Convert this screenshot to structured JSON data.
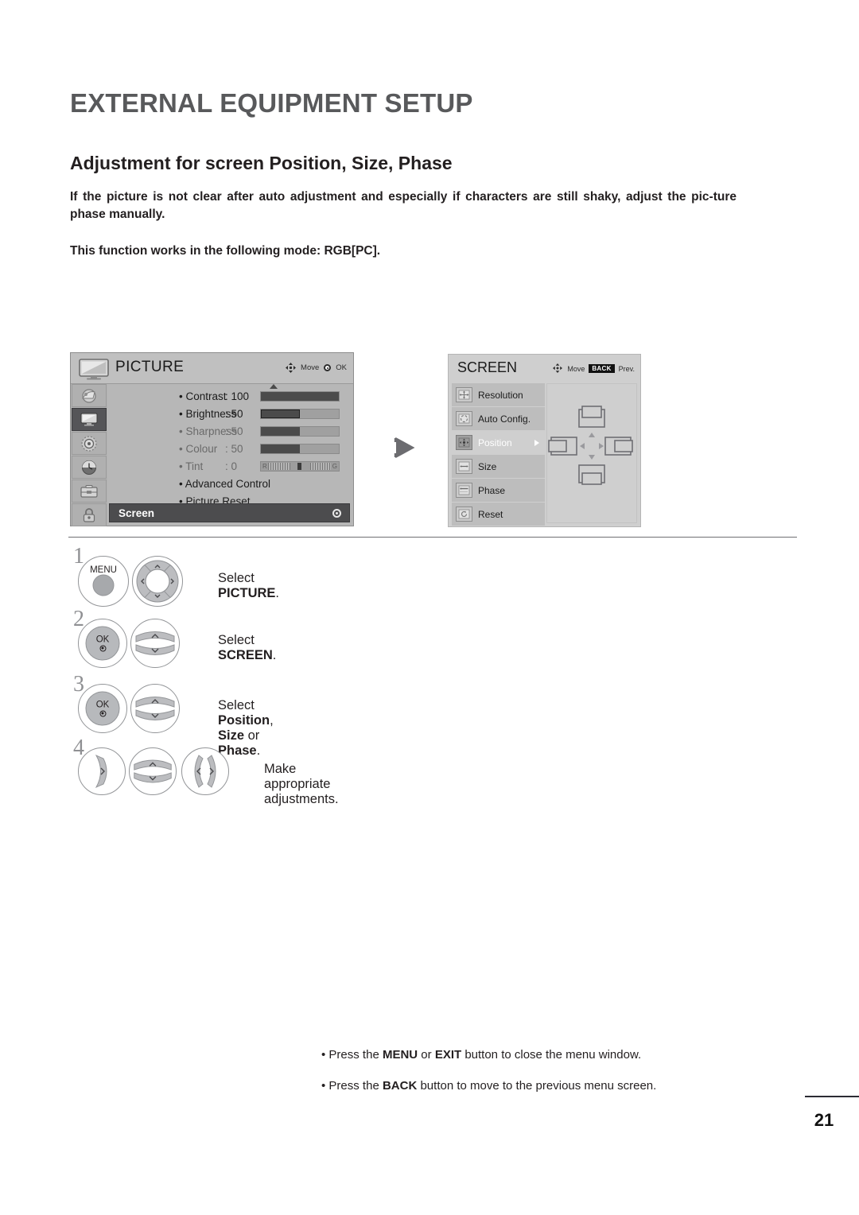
{
  "header": {
    "page_title": "EXTERNAL EQUIPMENT SETUP",
    "section_title": "Adjustment for screen Position, Size, Phase",
    "paragraph_1": "If the picture is not clear after auto adjustment and especially if characters are still shaky, adjust the pic-ture phase manually.",
    "paragraph_2": "This function works in the following mode: RGB[PC]."
  },
  "picture_menu": {
    "title": "PICTURE",
    "hint_move": "Move",
    "hint_ok": "OK",
    "rail_icons": [
      "setup-icon",
      "picture-icon",
      "audio-icon",
      "time-icon",
      "option-icon",
      "lock-icon"
    ],
    "active_rail_index": 1,
    "items": [
      {
        "label": "Contrast",
        "value": ": 100",
        "fill": 100,
        "dim": false,
        "type": "slider"
      },
      {
        "label": "Brightness",
        "value": ": 50",
        "fill": 50,
        "dim": false,
        "type": "slider"
      },
      {
        "label": "Sharpness",
        "value": ": 50",
        "fill": 50,
        "dim": true,
        "type": "slider"
      },
      {
        "label": "Colour",
        "value": ": 50",
        "fill": 50,
        "dim": true,
        "type": "slider"
      },
      {
        "label": "Tint",
        "value": ": 0",
        "fill": 50,
        "dim": true,
        "type": "tint"
      },
      {
        "label": "Advanced Control",
        "value": "",
        "fill": 0,
        "dim": false,
        "type": "plain"
      },
      {
        "label": "Picture Reset",
        "value": "",
        "fill": 0,
        "dim": false,
        "type": "plain"
      }
    ],
    "tint_left_label": "R",
    "tint_right_label": "G",
    "selected_row": "Screen"
  },
  "screen_menu": {
    "title": "SCREEN",
    "hint_move": "Move",
    "hint_back_chip": "BACK",
    "hint_back_label": "Prev.",
    "items": [
      {
        "label": "Resolution",
        "icon": "resolution-icon",
        "selected": false
      },
      {
        "label": "Auto Config.",
        "icon": "auto-config-icon",
        "selected": false
      },
      {
        "label": "Position",
        "icon": "position-icon",
        "selected": true
      },
      {
        "label": "Size",
        "icon": "size-icon",
        "selected": false
      },
      {
        "label": "Phase",
        "icon": "phase-icon",
        "selected": false
      },
      {
        "label": "Reset",
        "icon": "reset-icon",
        "selected": false
      }
    ]
  },
  "steps": [
    {
      "num": "1",
      "text_plain": "Select ",
      "text_bold": "PICTURE",
      "text_tail": ".",
      "menu_label": "MENU"
    },
    {
      "num": "2",
      "text_plain": "Select ",
      "text_bold": "SCREEN",
      "text_tail": ".",
      "ok_label": "OK"
    },
    {
      "num": "3",
      "text_plain": "Select ",
      "text_bold": "Position",
      "text_mid": ", ",
      "text_bold2": "Size",
      "text_mid2": " or ",
      "text_bold3": "Phase",
      "text_tail": ".",
      "ok_label": "OK"
    },
    {
      "num": "4",
      "text_plain": "Make appropriate adjustments."
    }
  ],
  "notes": {
    "note_1_pre": "• Press the ",
    "note_1_b1": "MENU",
    "note_1_mid": " or ",
    "note_1_b2": "EXIT",
    "note_1_post": " button to close the menu window.",
    "note_2_pre": "• Press the ",
    "note_2_b1": "BACK",
    "note_2_post": " button to move to the previous menu screen."
  },
  "page_number": "21",
  "colors": {
    "title_grey": "#58595b",
    "osd_dark": "#4c4c4e",
    "osd_light": "#b7b7b7",
    "button_grey": "#bcbdc0"
  }
}
